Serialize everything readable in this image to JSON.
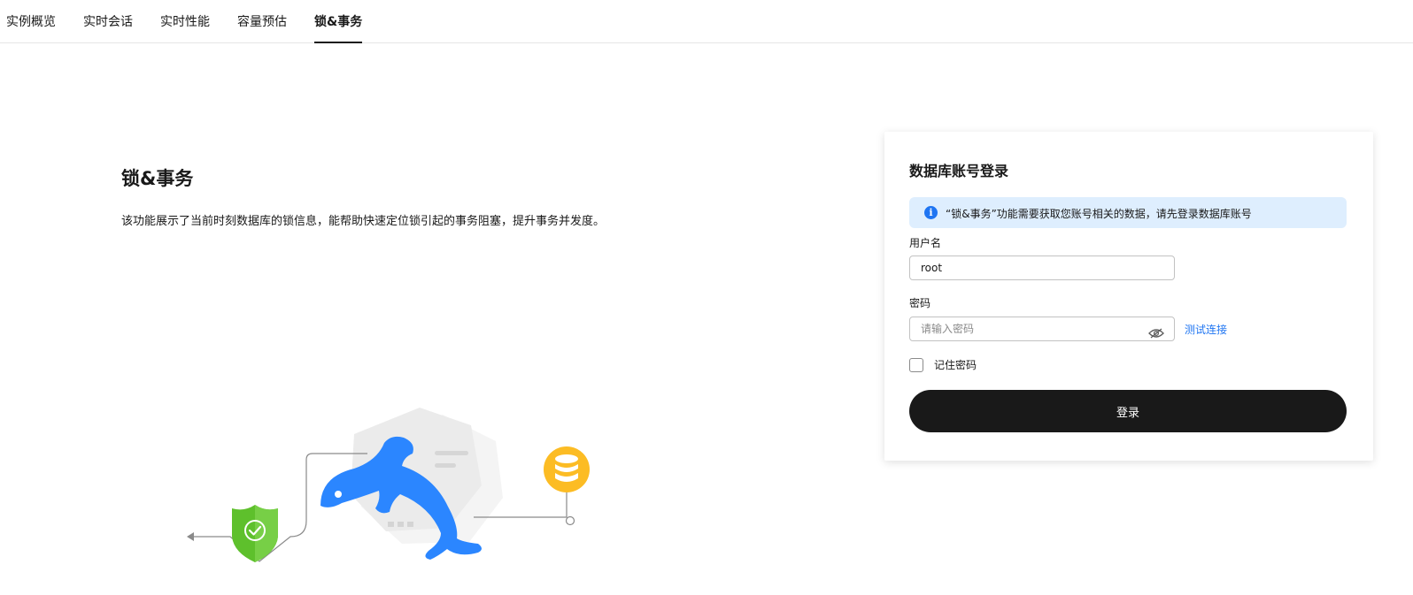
{
  "tabs": [
    {
      "label": "实例概览",
      "active": false
    },
    {
      "label": "实时会话",
      "active": false
    },
    {
      "label": "实时性能",
      "active": false
    },
    {
      "label": "容量预估",
      "active": false
    },
    {
      "label": "锁&事务",
      "active": true
    }
  ],
  "intro": {
    "title": "锁&事务",
    "description": "该功能展示了当前时刻数据库的锁信息，能帮助快速定位锁引起的事务阻塞，提升事务并发度。"
  },
  "login": {
    "title": "数据库账号登录",
    "notice": "“锁&事务”功能需要获取您账号相关的数据，请先登录数据库账号",
    "username_label": "用户名",
    "username_value": "root",
    "password_label": "密码",
    "password_placeholder": "请输入密码",
    "test_connection": "测试连接",
    "remember_label": "记住密码",
    "remember_checked": false,
    "submit_label": "登录"
  },
  "colors": {
    "accent": "#1f75f2",
    "notice_bg": "#deeefe",
    "primary_button": "#191919",
    "dolphin": "#2b86ff",
    "shield": "#5ec02c",
    "database": "#fcbc24"
  },
  "icons": {
    "info": "info-icon",
    "password_toggle": "eye-off-icon"
  }
}
